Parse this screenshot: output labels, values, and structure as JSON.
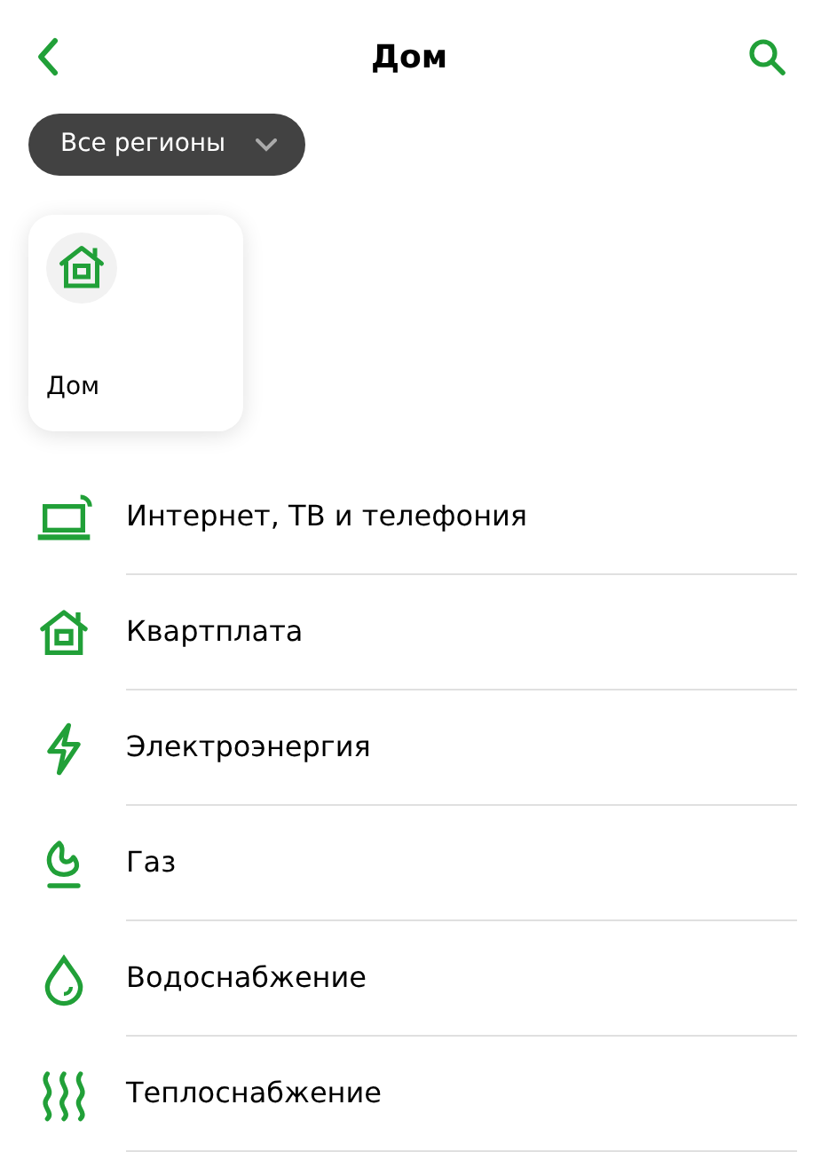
{
  "header": {
    "title": "Дом"
  },
  "region_filter": {
    "label": "Все регионы"
  },
  "cards": [
    {
      "label": "Дом",
      "kind": "house"
    }
  ],
  "categories": [
    {
      "label": "Интернет, ТВ и телефония",
      "kind": "internet"
    },
    {
      "label": "Квартплата",
      "kind": "house"
    },
    {
      "label": "Электроэнергия",
      "kind": "bolt"
    },
    {
      "label": "Газ",
      "kind": "gas"
    },
    {
      "label": "Водоснабжение",
      "kind": "water"
    },
    {
      "label": "Теплоснабжение",
      "kind": "heat"
    }
  ]
}
